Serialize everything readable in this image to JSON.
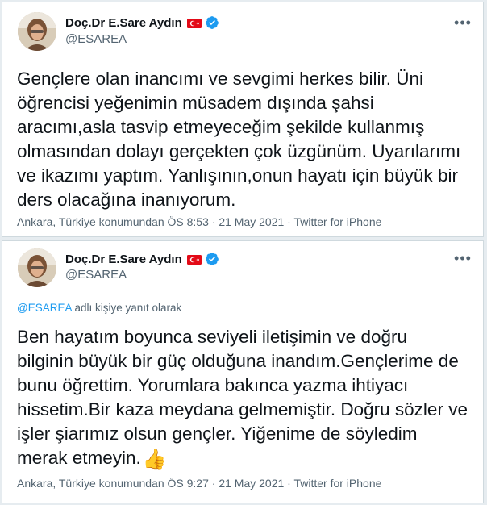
{
  "tweets": [
    {
      "author_name": "Doç.Dr E.Sare Aydın",
      "handle": "@ESAREA",
      "text": "Gençlere olan inancımı ve sevgimi herkes bilir. Üni\nöğrencisi yeğenimin müsadem dışında şahsi\naracımı,asla tasvip etmeyeceğim şekilde kullanmış\nolmasından dolayı gerçekten çok üzgünüm. Uyarılarımı\nve ikazımı yaptım. Yanlışının,onun hayatı için büyük bir\nders olacağına inanıyorum.",
      "location_time": "Ankara, Türkiye konumundan ÖS 8:53 · 21 May 2021 · Twitter for iPhone"
    },
    {
      "author_name": "Doç.Dr E.Sare Aydın",
      "handle": "@ESAREA",
      "reply_mention": "@ESAREA",
      "reply_suffix": " adlı kişiye yanıt olarak",
      "text": "Ben hayatım boyunca seviyeli iletişimin ve doğru\nbilginin büyük bir güç olduğuna inandım.Gençlerime de\nbunu öğrettim. Yorumlara bakınca yazma ihtiyacı\nhissetim.Bir kaza meydana gelmemiştir. Doğru sözler ve\nişler şiarımız olsun gençler. Yiğenime de söyledim\nmerak etmeyin.",
      "emoji": "👍",
      "location_time": "Ankara, Türkiye konumundan ÖS 9:27 · 21 May 2021 · Twitter for iPhone"
    }
  ],
  "icons": {
    "more": "more-icon",
    "flag": "turkey-flag-icon",
    "verified": "verified-badge-icon"
  },
  "colors": {
    "background": "#e6ecf0",
    "text": "#0f1419",
    "secondary": "#536471",
    "link": "#1d9bf0",
    "verified": "#1d9bf0",
    "flag_red": "#e30a17"
  }
}
